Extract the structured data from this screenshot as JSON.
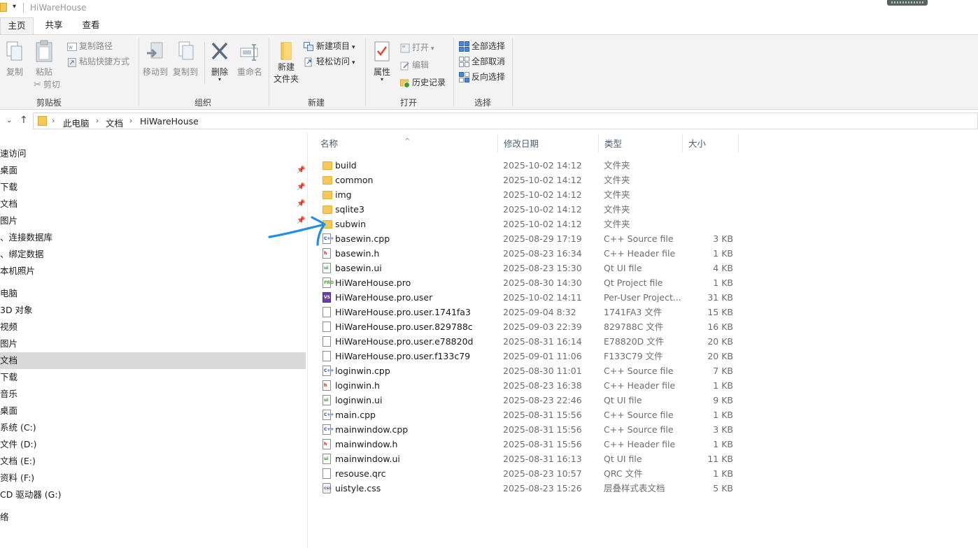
{
  "window": {
    "title": "HiWareHouse"
  },
  "ribbon_tabs": [
    "主页",
    "共享",
    "查看"
  ],
  "ribbon": {
    "clipboard": {
      "copy": "复制",
      "paste": "粘贴",
      "copy_path": "复制路径",
      "paste_shortcut": "粘贴快捷方式",
      "cut": "剪切",
      "group": "剪贴板"
    },
    "organize": {
      "move_to": "移动到",
      "copy_to": "复制到",
      "delete": "删除",
      "rename": "重命名",
      "group": "组织"
    },
    "new": {
      "new_folder_line1": "新建",
      "new_folder_line2": "文件夹",
      "new_item": "新建项目",
      "easy_access": "轻松访问",
      "group": "新建"
    },
    "open": {
      "properties": "属性",
      "open": "打开",
      "edit": "编辑",
      "history": "历史记录",
      "group": "打开"
    },
    "select": {
      "select_all": "全部选择",
      "select_none": "全部取消",
      "invert": "反向选择",
      "group": "选择"
    }
  },
  "address": {
    "crumbs": [
      "此电脑",
      "文档",
      "HiWareHouse"
    ]
  },
  "nav_pane": {
    "items": [
      "速访问",
      "桌面",
      "下载",
      "文档",
      "图片",
      "、连接数据库",
      "、绑定数据",
      "本机照片",
      "电脑",
      "3D 对象",
      "视频",
      "图片",
      "文档",
      "下载",
      "音乐",
      "桌面",
      "系统 (C:)",
      "文件 (D:)",
      "文档 (E:)",
      "资料 (F:)",
      "CD 驱动器 (G:)",
      "络"
    ],
    "selected_index": 12
  },
  "columns": {
    "name": "名称",
    "date": "修改日期",
    "type": "类型",
    "size": "大小"
  },
  "files": [
    {
      "icon": "folder",
      "name": "build",
      "date": "2025-10-02 14:12",
      "type": "文件夹",
      "size": ""
    },
    {
      "icon": "folder",
      "name": "common",
      "date": "2025-10-02 14:12",
      "type": "文件夹",
      "size": ""
    },
    {
      "icon": "folder",
      "name": "img",
      "date": "2025-10-02 14:12",
      "type": "文件夹",
      "size": ""
    },
    {
      "icon": "folder",
      "name": "sqlite3",
      "date": "2025-10-02 14:12",
      "type": "文件夹",
      "size": ""
    },
    {
      "icon": "folder",
      "name": "subwin",
      "date": "2025-10-02 14:12",
      "type": "文件夹",
      "size": ""
    },
    {
      "icon": "cpp",
      "name": "basewin.cpp",
      "date": "2025-08-29 17:19",
      "type": "C++ Source file",
      "size": "3 KB"
    },
    {
      "icon": "h",
      "name": "basewin.h",
      "date": "2025-08-23 16:34",
      "type": "C++ Header file",
      "size": "1 KB"
    },
    {
      "icon": "ui",
      "name": "basewin.ui",
      "date": "2025-08-23 15:30",
      "type": "Qt UI file",
      "size": "4 KB"
    },
    {
      "icon": "pro",
      "name": "HiWareHouse.pro",
      "date": "2025-08-30 14:30",
      "type": "Qt Project file",
      "size": "1 KB"
    },
    {
      "icon": "vs",
      "name": "HiWareHouse.pro.user",
      "date": "2025-10-02 14:11",
      "type": "Per-User Project...",
      "size": "31 KB"
    },
    {
      "icon": "doc",
      "name": "HiWareHouse.pro.user.1741fa3",
      "date": "2025-09-04 8:32",
      "type": "1741FA3 文件",
      "size": "15 KB"
    },
    {
      "icon": "doc",
      "name": "HiWareHouse.pro.user.829788c",
      "date": "2025-09-03 22:39",
      "type": "829788C 文件",
      "size": "16 KB"
    },
    {
      "icon": "doc",
      "name": "HiWareHouse.pro.user.e78820d",
      "date": "2025-08-31 16:14",
      "type": "E78820D 文件",
      "size": "20 KB"
    },
    {
      "icon": "doc",
      "name": "HiWareHouse.pro.user.f133c79",
      "date": "2025-09-01 11:06",
      "type": "F133C79 文件",
      "size": "20 KB"
    },
    {
      "icon": "cpp",
      "name": "loginwin.cpp",
      "date": "2025-08-30 11:01",
      "type": "C++ Source file",
      "size": "7 KB"
    },
    {
      "icon": "h",
      "name": "loginwin.h",
      "date": "2025-08-23 16:38",
      "type": "C++ Header file",
      "size": "1 KB"
    },
    {
      "icon": "ui",
      "name": "loginwin.ui",
      "date": "2025-08-23 22:46",
      "type": "Qt UI file",
      "size": "9 KB"
    },
    {
      "icon": "cpp",
      "name": "main.cpp",
      "date": "2025-08-31 15:56",
      "type": "C++ Source file",
      "size": "1 KB"
    },
    {
      "icon": "cpp",
      "name": "mainwindow.cpp",
      "date": "2025-08-31 15:56",
      "type": "C++ Source file",
      "size": "3 KB"
    },
    {
      "icon": "h",
      "name": "mainwindow.h",
      "date": "2025-08-31 15:56",
      "type": "C++ Header file",
      "size": "1 KB"
    },
    {
      "icon": "ui",
      "name": "mainwindow.ui",
      "date": "2025-08-31 16:13",
      "type": "Qt UI file",
      "size": "11 KB"
    },
    {
      "icon": "doc",
      "name": "resouse.qrc",
      "date": "2025-08-23 10:57",
      "type": "QRC 文件",
      "size": "1 KB"
    },
    {
      "icon": "css",
      "name": "uistyle.css",
      "date": "2025-08-23 15:26",
      "type": "层叠样式表文档",
      "size": "5 KB"
    }
  ],
  "annotation": {
    "color": "#1e8fe6"
  }
}
